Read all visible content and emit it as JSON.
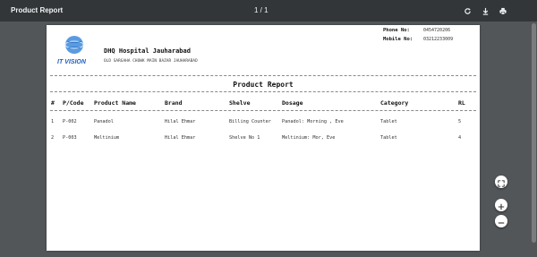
{
  "toolbar": {
    "title": "Product Report",
    "pages": "1 / 1"
  },
  "icons": {
    "rotate": "rotate-icon",
    "download": "download-icon",
    "print": "print-icon",
    "fit": "fit-page-icon",
    "zoom_in": "zoom-in-icon",
    "zoom_out": "zoom-out-icon"
  },
  "header": {
    "logo_text": "IT VISION",
    "hospital_name": "DHQ Hospital Jauharabad",
    "address": "OLD SARGAHA CHOWK MAIN BAZAR JAUHARABAD",
    "phone_label": "Phone No:",
    "phone": "0454720206",
    "mobile_label": "Mobile No:",
    "mobile": "03212233009"
  },
  "report": {
    "title": "Product Report",
    "columns": [
      "#",
      "P/Code",
      "Product Name",
      "Brand",
      "Shelve",
      "Dosage",
      "Category",
      "RL"
    ],
    "rows": [
      [
        "1",
        "P-002",
        "Panadol",
        "Hilal Ehmar",
        "Billing Counter",
        "Panadol: Morning , Eve",
        "Tablet",
        "5"
      ],
      [
        "2",
        "P-003",
        "Meltinium",
        "Hilal Ehmar",
        "Shelve No 1",
        "Meltinium: Mor, Eve",
        "Tablet",
        "4"
      ]
    ]
  },
  "colors": {
    "viewer_bg": "#525659",
    "toolbar_bg": "#323639",
    "logo_blue": "#1f5fbf"
  }
}
